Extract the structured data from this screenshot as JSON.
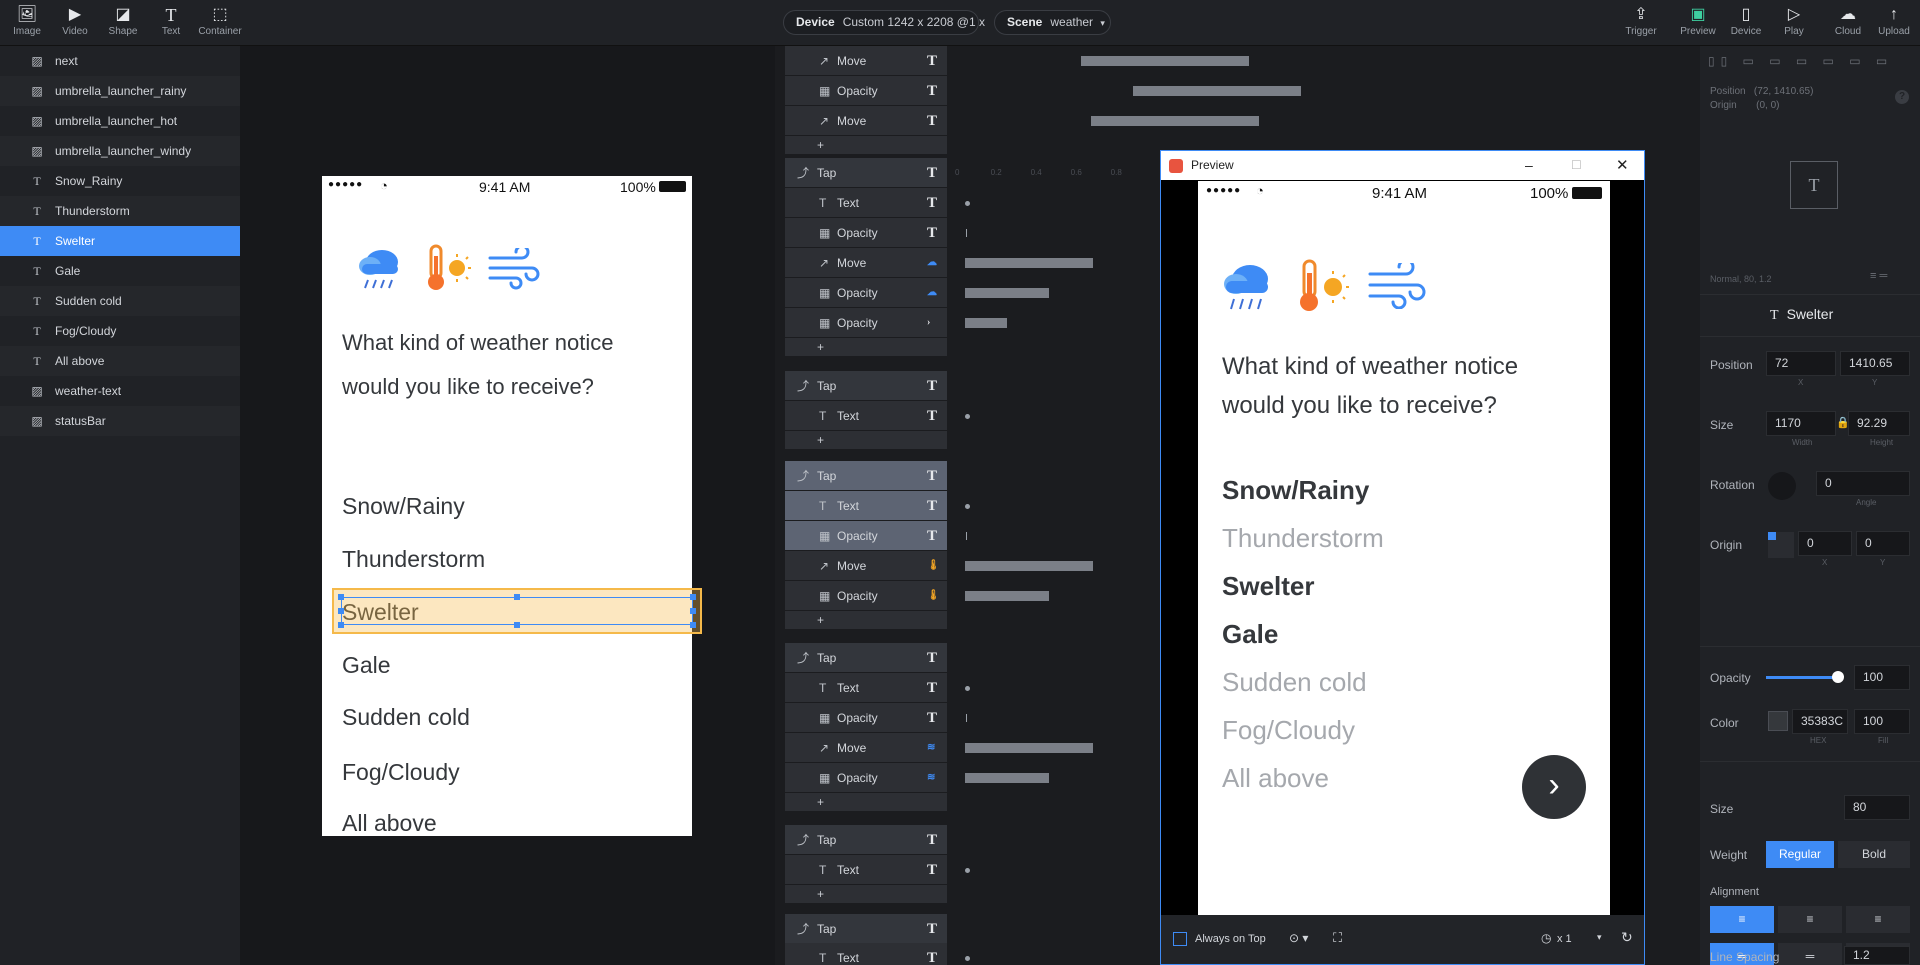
{
  "toolbar": {
    "left_tools": [
      {
        "icon": "image-icon",
        "label": "Image"
      },
      {
        "icon": "video-icon",
        "label": "Video"
      },
      {
        "icon": "shape-icon",
        "label": "Shape"
      },
      {
        "icon": "text-icon",
        "label": "Text"
      },
      {
        "icon": "container-icon",
        "label": "Container"
      }
    ],
    "device_label": "Device",
    "device_value": "Custom  1242 x 2208  @1 x",
    "scene_label": "Scene",
    "scene_value": "weather",
    "right_tools": [
      {
        "icon": "trigger-icon",
        "label": "Trigger"
      },
      {
        "icon": "preview-icon",
        "label": "Preview"
      },
      {
        "icon": "device-icon",
        "label": "Device"
      },
      {
        "icon": "play-icon",
        "label": "Play"
      },
      {
        "icon": "cloud-icon",
        "label": "Cloud"
      },
      {
        "icon": "upload-icon",
        "label": "Upload"
      }
    ]
  },
  "layers": [
    {
      "type": "image",
      "name": "next"
    },
    {
      "type": "image",
      "name": "umbrella_launcher_rainy"
    },
    {
      "type": "image",
      "name": "umbrella_launcher_hot"
    },
    {
      "type": "image",
      "name": "umbrella_launcher_windy"
    },
    {
      "type": "text",
      "name": "Snow_Rainy"
    },
    {
      "type": "text",
      "name": "Thunderstorm"
    },
    {
      "type": "text",
      "name": "Swelter"
    },
    {
      "type": "text",
      "name": "Gale"
    },
    {
      "type": "text",
      "name": "Sudden cold"
    },
    {
      "type": "text",
      "name": "Fog/Cloudy"
    },
    {
      "type": "text",
      "name": "All above"
    },
    {
      "type": "image",
      "name": "weather-text"
    },
    {
      "type": "image",
      "name": "statusBar"
    }
  ],
  "phone": {
    "status_signal": "●●●●●",
    "status_time": "9:41 AM",
    "status_battery": "100%",
    "question_line1": "What kind of weather notice",
    "question_line2": "would you like to receive?",
    "options": [
      "Snow/Rainy",
      "Thunderstorm",
      "Swelter",
      "Gale",
      "Sudden cold",
      "Fog/Cloudy",
      "All above"
    ]
  },
  "timeline": {
    "ruler": [
      "0",
      "0.2",
      "0.4",
      "0.6",
      "0.8",
      "3.4"
    ],
    "groups": [
      {
        "header": null,
        "rows": [
          {
            "icon": "move-icon",
            "label": "Move"
          },
          {
            "icon": "opacity-icon",
            "label": "Opacity"
          },
          {
            "icon": "move-icon",
            "label": "Move"
          }
        ]
      },
      {
        "header": "Tap",
        "rows": [
          {
            "icon": "text-icon",
            "label": "Text"
          },
          {
            "icon": "opacity-icon",
            "label": "Opacity"
          },
          {
            "icon": "move-icon",
            "label": "Move"
          },
          {
            "icon": "opacity-icon",
            "label": "Opacity"
          },
          {
            "icon": "opacity-icon",
            "label": "Opacity"
          }
        ]
      },
      {
        "header": "Tap",
        "rows": [
          {
            "icon": "text-icon",
            "label": "Text"
          }
        ]
      },
      {
        "header": "Tap",
        "rows": [
          {
            "icon": "text-icon",
            "label": "Text"
          },
          {
            "icon": "opacity-icon",
            "label": "Opacity"
          },
          {
            "icon": "move-icon",
            "label": "Move"
          },
          {
            "icon": "opacity-icon",
            "label": "Opacity"
          }
        ]
      },
      {
        "header": "Tap",
        "rows": [
          {
            "icon": "text-icon",
            "label": "Text"
          },
          {
            "icon": "opacity-icon",
            "label": "Opacity"
          },
          {
            "icon": "move-icon",
            "label": "Move"
          },
          {
            "icon": "opacity-icon",
            "label": "Opacity"
          }
        ]
      },
      {
        "header": "Tap",
        "rows": [
          {
            "icon": "text-icon",
            "label": "Text"
          }
        ]
      },
      {
        "header": "Tap",
        "rows": [
          {
            "icon": "text-icon",
            "label": "Text"
          }
        ]
      }
    ],
    "add_label": "+",
    "trigger_glyph": "T"
  },
  "preview": {
    "title": "Preview",
    "status_time": "9:41 AM",
    "status_battery": "100%",
    "status_signal": "●●●●●",
    "question_line1": "What kind of weather notice",
    "question_line2": "would you like to receive?",
    "options": [
      {
        "label": "Snow/Rainy",
        "state": "selected"
      },
      {
        "label": "Thunderstorm",
        "state": "dim"
      },
      {
        "label": "Swelter",
        "state": "selected"
      },
      {
        "label": "Gale",
        "state": "selected"
      },
      {
        "label": "Sudden cold",
        "state": "dim"
      },
      {
        "label": "Fog/Cloudy",
        "state": "dim"
      },
      {
        "label": "All above",
        "state": "dim"
      }
    ],
    "always_on_top": "Always on Top",
    "speed": "x 1"
  },
  "inspector": {
    "pos_readout_label": "Position",
    "pos_readout_value": "(72, 1410.65)",
    "origin_readout_label": "Origin",
    "origin_readout_value": "(0, 0)",
    "font_summary": "Normal, 80, 1.2",
    "layer_name": "Swelter",
    "position_label": "Position",
    "position_x": "72",
    "position_y": "1410.65",
    "x_sub": "X",
    "y_sub": "Y",
    "size_label": "Size",
    "width": "1170",
    "height": "92.29",
    "width_sub": "Width",
    "height_sub": "Height",
    "rotation_label": "Rotation",
    "angle": "0",
    "angle_sub": "Angle",
    "origin_label": "Origin",
    "origin_x": "0",
    "origin_y": "0",
    "opacity_label": "Opacity",
    "opacity_value": "100",
    "opacity_fraction": 1.0,
    "color_label": "Color",
    "color_hex": "35383C",
    "color_fill": "100",
    "hex_sub": "HEX",
    "fill_sub": "Fill",
    "font_size_label": "Size",
    "font_size": "80",
    "weight_label": "Weight",
    "weight_regular": "Regular",
    "weight_bold": "Bold",
    "alignment_label": "Alignment",
    "line_spacing_label": "Line Spacing",
    "line_spacing": "1.2"
  },
  "colors": {
    "accent": "#3e8bf5",
    "text": "#35383c",
    "selection": "#f5b94a"
  }
}
